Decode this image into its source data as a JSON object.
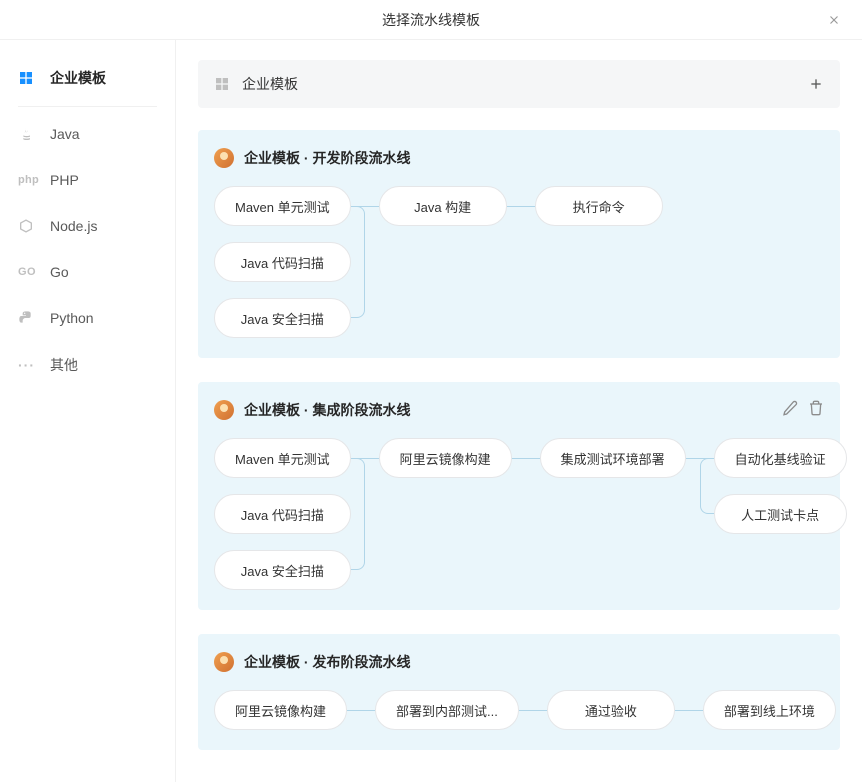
{
  "modal": {
    "title": "选择流水线模板"
  },
  "sidebar": {
    "items": [
      {
        "label": "企业模板",
        "icon": "grid-icon",
        "active": true
      },
      {
        "label": "Java",
        "icon": "java-icon"
      },
      {
        "label": "PHP",
        "icon": "php-icon"
      },
      {
        "label": "Node.js",
        "icon": "node-icon"
      },
      {
        "label": "Go",
        "icon": "go-icon"
      },
      {
        "label": "Python",
        "icon": "python-icon"
      },
      {
        "label": "其他",
        "icon": "dots-icon"
      }
    ]
  },
  "section": {
    "title": "企业模板"
  },
  "templates": [
    {
      "title": "企业模板 · 开发阶段流水线",
      "stages": {
        "col1": [
          "Maven 单元测试",
          "Java 代码扫描",
          "Java 安全扫描"
        ],
        "col2": [
          "Java 构建"
        ],
        "col3": [
          "执行命令"
        ]
      }
    },
    {
      "title": "企业模板 · 集成阶段流水线",
      "has_actions": true,
      "stages": {
        "col1": [
          "Maven 单元测试",
          "Java 代码扫描",
          "Java 安全扫描"
        ],
        "col2": [
          "阿里云镜像构建"
        ],
        "col3": [
          "集成测试环境部署"
        ],
        "col4": [
          "自动化基线验证",
          "人工测试卡点"
        ]
      }
    },
    {
      "title": "企业模板 · 发布阶段流水线",
      "stages": {
        "col1": [
          "阿里云镜像构建"
        ],
        "col2": [
          "部署到内部测试..."
        ],
        "col3": [
          "通过验收"
        ],
        "col4": [
          "部署到线上环境"
        ]
      }
    }
  ]
}
